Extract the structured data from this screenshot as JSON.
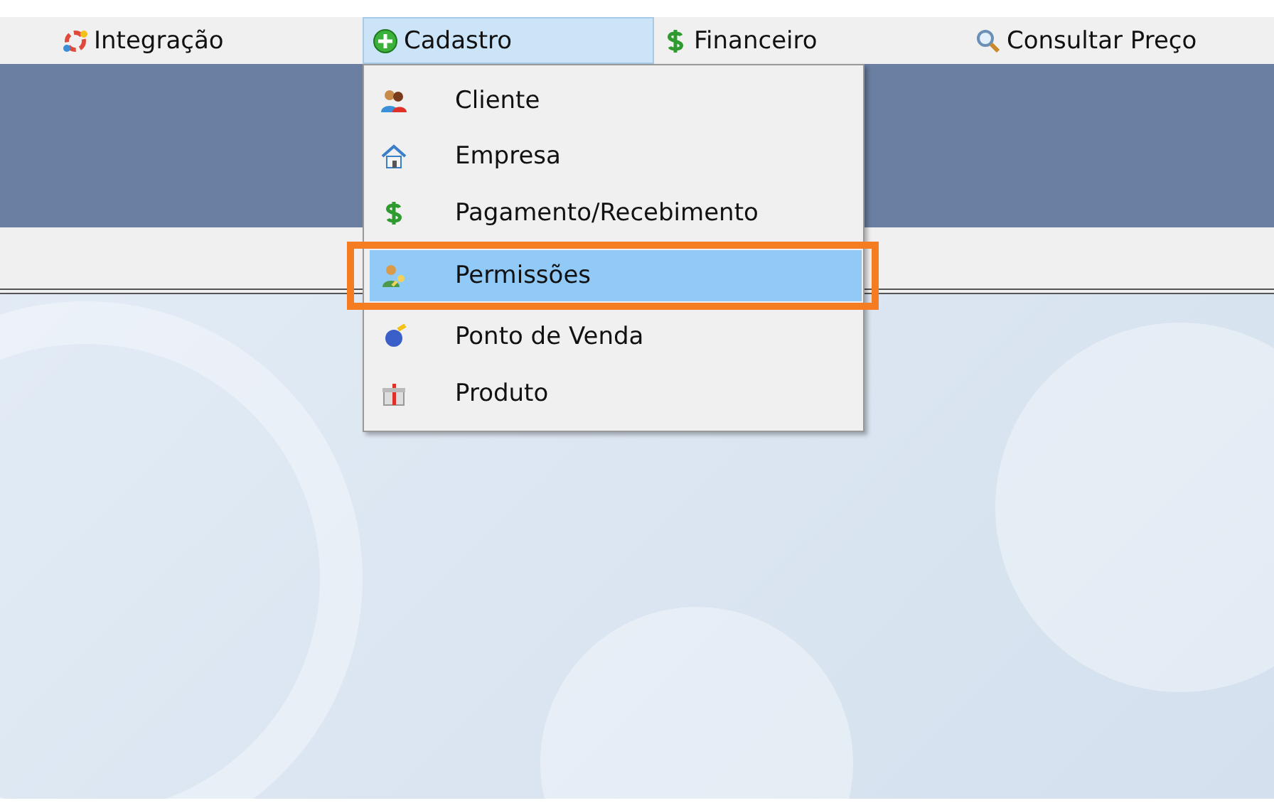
{
  "menu_bar": [
    {
      "label": "Integração",
      "selected": false
    },
    {
      "label": "Cadastro",
      "selected": true
    },
    {
      "label": "Financeiro",
      "selected": false
    },
    {
      "label": "Consultar Preço",
      "selected": false
    }
  ],
  "dropdown": {
    "items": [
      {
        "label": "Cliente",
        "selected": false,
        "callout": false
      },
      {
        "label": "Empresa",
        "selected": false,
        "callout": false
      },
      {
        "label": "Pagamento/Recebimento",
        "selected": false,
        "callout": false
      },
      {
        "label": "Permissões",
        "selected": true,
        "callout": true
      },
      {
        "label": "Ponto de Venda",
        "selected": false,
        "callout": false
      },
      {
        "label": "Produto",
        "selected": false,
        "callout": false
      }
    ]
  }
}
